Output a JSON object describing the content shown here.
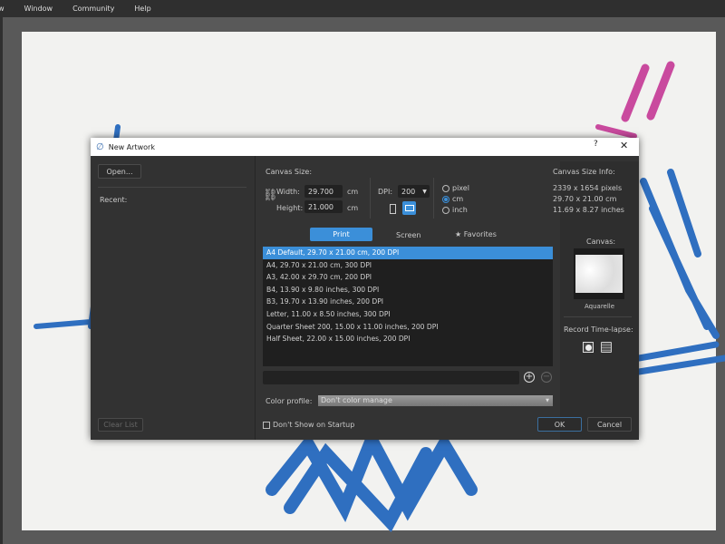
{
  "menu": [
    "w",
    "Window",
    "Community",
    "Help"
  ],
  "dialog": {
    "title": "New Artwork",
    "help": "?",
    "close": "✕",
    "open_button": "Open...",
    "recent_label": "Recent:",
    "clear_list_button": "Clear List",
    "canvas_size_label": "Canvas Size:",
    "width_label": "Width:",
    "width_value": "29.700",
    "height_label": "Height:",
    "height_value": "21.000",
    "unit_cm": "cm",
    "dpi_label": "DPI:",
    "dpi_value": "200",
    "units": [
      {
        "label": "pixel",
        "selected": false
      },
      {
        "label": "cm",
        "selected": true
      },
      {
        "label": "inch",
        "selected": false
      }
    ],
    "info_label": "Canvas Size Info:",
    "info": [
      "2339 x 1654 pixels",
      "29.70 x 21.00 cm",
      "11.69 x 8.27 inches"
    ],
    "tabs": [
      "Print",
      "Screen",
      "Favorites"
    ],
    "active_tab": "Print",
    "presets": [
      "A4 Default, 29.70 x 21.00 cm, 200 DPI",
      "A4, 29.70 x 21.00 cm, 300 DPI",
      "A3, 42.00 x 29.70 cm, 200 DPI",
      "B4, 13.90 x 9.80 inches, 300 DPI",
      "B3, 19.70 x 13.90 inches, 200 DPI",
      "Letter, 11.00 x 8.50 inches, 300 DPI",
      "Quarter Sheet 200, 15.00 x 11.00 inches, 200 DPI",
      "Half Sheet, 22.00 x 15.00 inches, 200 DPI"
    ],
    "preset_name_value": "",
    "color_profile_label": "Color profile:",
    "color_profile_value": "Don't color manage",
    "canvas_label": "Canvas:",
    "canvas_name": "Aquarelle",
    "timelapse_label": "Record Time-lapse:",
    "dont_show_label": "Don't Show on Startup",
    "ok": "OK",
    "cancel": "Cancel"
  },
  "colors": {
    "accent": "#3b8fd9",
    "stroke_blue": "#2f6fc0",
    "stroke_pink": "#c94a9e"
  }
}
